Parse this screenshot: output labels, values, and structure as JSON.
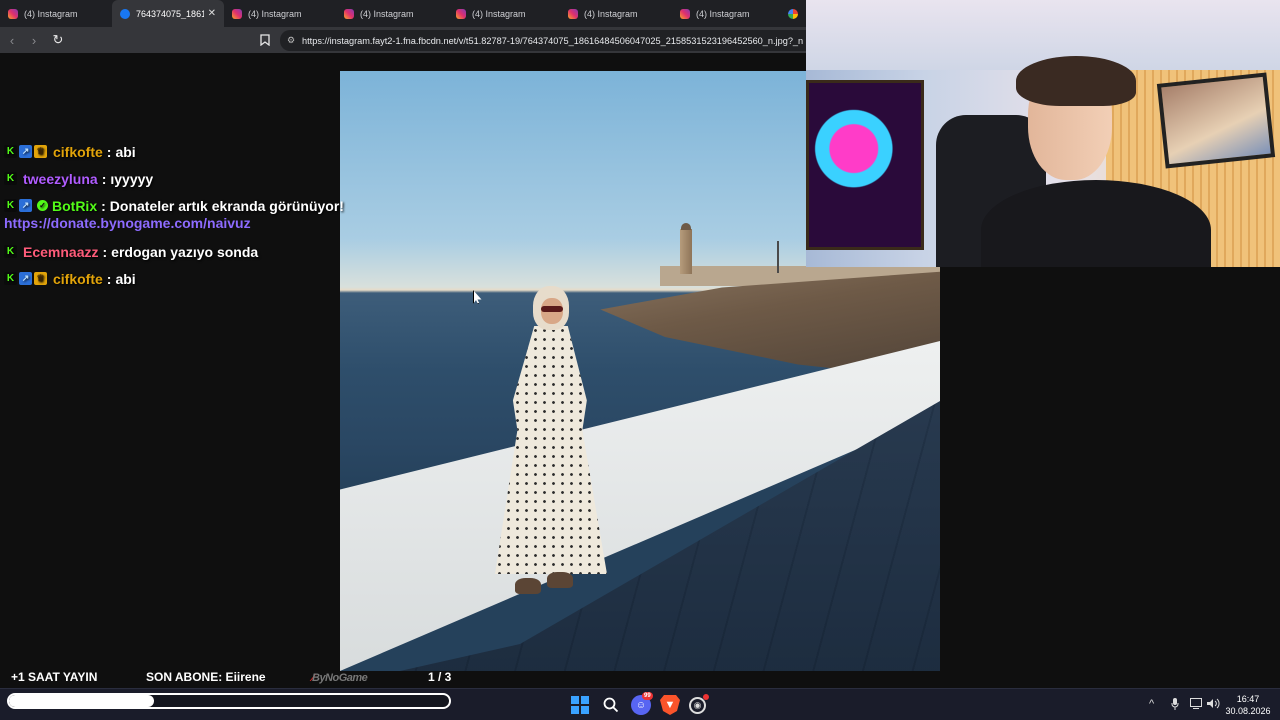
{
  "browser": {
    "tabs": [
      {
        "title": "(4) Instagram",
        "icon": "instagram-icon",
        "active": false
      },
      {
        "title": "764374075_1861€",
        "icon": "facebook-icon",
        "active": true
      },
      {
        "title": "(4) Instagram",
        "icon": "instagram-icon",
        "active": false
      },
      {
        "title": "(4) Instagram",
        "icon": "instagram-icon",
        "active": false
      },
      {
        "title": "(4) Instagram",
        "icon": "instagram-icon",
        "active": false
      },
      {
        "title": "(4) Instagram",
        "icon": "instagram-icon",
        "active": false
      },
      {
        "title": "(4) Instagram",
        "icon": "instagram-icon",
        "active": false
      }
    ],
    "url": "https://instagram.fayt2-1.fna.fbcdn.net/v/t51.82787-19/764374075_18616484506047025_2158531523196452560_n.jpg?_n",
    "close_glyph": "✕",
    "back_glyph": "‹",
    "forward_glyph": "›",
    "reload_glyph": "↻",
    "bookmark_glyph": "⌖"
  },
  "chat": {
    "messages": [
      {
        "user": "cifkofte",
        "color": "#e2a40a",
        "badges": [
          "kick",
          "og",
          "sub"
        ],
        "text": "abi"
      },
      {
        "user": "tweezyluna",
        "color": "#b05cff",
        "badges": [
          "kick"
        ],
        "text": "ıyyyyy"
      },
      {
        "user": "BotRix",
        "color": "#53fc18",
        "badges": [
          "kick",
          "og",
          "verified"
        ],
        "text": "Donateler artık ekranda görünüyor!",
        "link": "https://donate.bynogame.com/naivuz"
      },
      {
        "user": "Ecemnaazz",
        "color": "#ff5c7a",
        "badges": [
          "kick"
        ],
        "text": "erdogan yazıyo sonda"
      },
      {
        "user": "cifkofte",
        "color": "#e2a40a",
        "badges": [
          "kick",
          "og",
          "sub"
        ],
        "text": "abi"
      }
    ]
  },
  "stream_bar": {
    "left": "+1 SAAT YAYIN",
    "last_sub": "SON ABONE: Eiirene",
    "sponsor": "ByNoGame",
    "page": "1 / 3"
  },
  "progress": {
    "value": 0.33
  },
  "taskbar": {
    "discord_badge": "99",
    "time": "16:47",
    "date": "30.08.2026",
    "tray_icons": [
      "chevron-up-icon",
      "microphone-icon",
      "network-icon",
      "speaker-icon"
    ]
  },
  "colors": {
    "chat_link": "#8d6bff",
    "kick_green": "#53fc18",
    "taskbar_bg": "#1a1c2a"
  }
}
